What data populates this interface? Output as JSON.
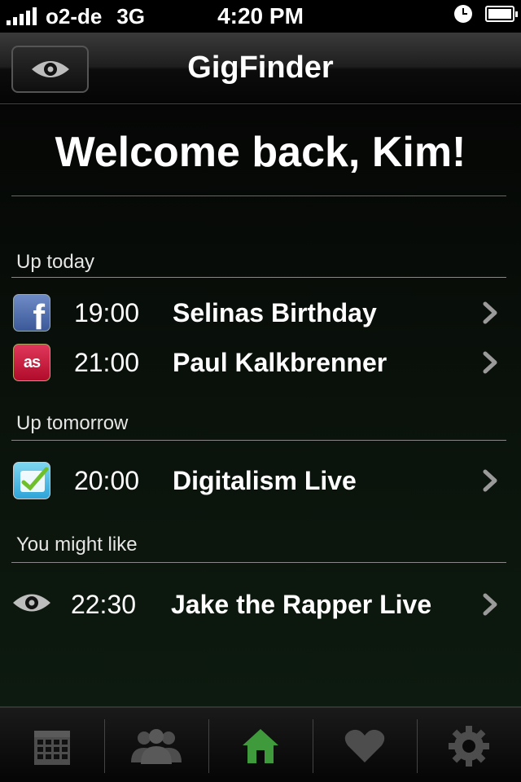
{
  "status_bar": {
    "carrier": "o2-de",
    "network": "3G",
    "time": "4:20 PM"
  },
  "nav": {
    "title": "GigFinder",
    "left_button_icon": "eye-icon"
  },
  "welcome": "Welcome back, Kim!",
  "sections": [
    {
      "label": "Up today",
      "items": [
        {
          "source_icon": "facebook-icon",
          "time": "19:00",
          "title": "Selinas Birthday"
        },
        {
          "source_icon": "lastfm-icon",
          "time": "21:00",
          "title": "Paul Kalkbrenner"
        }
      ]
    },
    {
      "label": "Up tomorrow",
      "items": [
        {
          "source_icon": "foursquare-icon",
          "time": "20:00",
          "title": "Digitalism Live"
        }
      ]
    },
    {
      "label": "You might like",
      "items": [
        {
          "source_icon": "eye-icon",
          "time": "22:30",
          "title": "Jake the Rapper Live"
        }
      ]
    }
  ],
  "tab_bar": {
    "tabs": [
      {
        "icon": "calendar-icon",
        "active": false
      },
      {
        "icon": "people-icon",
        "active": false
      },
      {
        "icon": "home-icon",
        "active": true
      },
      {
        "icon": "heart-icon",
        "active": false
      },
      {
        "icon": "gear-icon",
        "active": false
      }
    ]
  },
  "colors": {
    "active_tab": "#3f9a3c",
    "inactive_tab": "#4d4d4d",
    "background_green": "#0d1a0f"
  }
}
